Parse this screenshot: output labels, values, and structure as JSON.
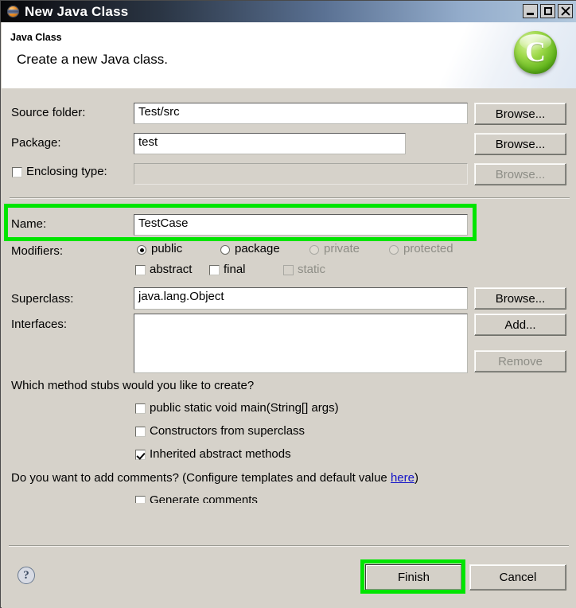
{
  "window": {
    "title": "New Java Class",
    "icon": "eclipse-icon",
    "controls": [
      {
        "name": "minimize-button",
        "glyph": "_"
      },
      {
        "name": "maximize-button",
        "glyph": "□"
      },
      {
        "name": "close-button",
        "glyph": "✕"
      }
    ]
  },
  "banner": {
    "title": "Java Class",
    "subtitle": "Create a new Java class.",
    "icon_letter": "C",
    "icon_name": "java-class-banner-icon"
  },
  "form": {
    "source_folder": {
      "label": "Source folder:",
      "value": "Test/src",
      "browse": "Browse...",
      "enabled": true
    },
    "package": {
      "label": "Package:",
      "value": "test",
      "placeholder": "",
      "browse": "Browse...",
      "enabled": true
    },
    "enclosing_type": {
      "label": "Enclosing type:",
      "value": "",
      "browse": "Browse...",
      "checked": false,
      "enabled": false
    },
    "name": {
      "label": "Name:",
      "value": "TestCase",
      "highlighted": true
    },
    "modifiers": {
      "label": "Modifiers:",
      "radios": [
        {
          "label": "public",
          "selected": true,
          "enabled": true
        },
        {
          "label": "package",
          "selected": false,
          "enabled": true
        },
        {
          "label": "private",
          "selected": false,
          "enabled": false
        },
        {
          "label": "protected",
          "selected": false,
          "enabled": false
        }
      ],
      "checkboxes": [
        {
          "label": "abstract",
          "checked": false,
          "enabled": true
        },
        {
          "label": "final",
          "checked": false,
          "enabled": true
        },
        {
          "label": "static",
          "checked": false,
          "enabled": false
        }
      ]
    },
    "superclass": {
      "label": "Superclass:",
      "value": "java.lang.Object",
      "browse": "Browse..."
    },
    "interfaces": {
      "label": "Interfaces:",
      "items": [],
      "add": "Add...",
      "remove": "Remove"
    }
  },
  "stubs": {
    "question": "Which method stubs would you like to create?",
    "options": [
      {
        "label": "public static void main(String[] args)",
        "checked": false
      },
      {
        "label": "Constructors from superclass",
        "checked": false
      },
      {
        "label": "Inherited abstract methods",
        "checked": true
      }
    ]
  },
  "comments": {
    "question_prefix": "Do you want to add comments? (Configure templates and default value ",
    "link": "here",
    "question_suffix": ")",
    "option": {
      "label": "Generate comments",
      "checked": false
    }
  },
  "footer": {
    "help": "?",
    "finish": "Finish",
    "cancel": "Cancel",
    "finish_highlighted": true
  },
  "annotations": {
    "highlight_color": "#00e500",
    "targets": [
      "name-field-row",
      "finish-button"
    ]
  }
}
